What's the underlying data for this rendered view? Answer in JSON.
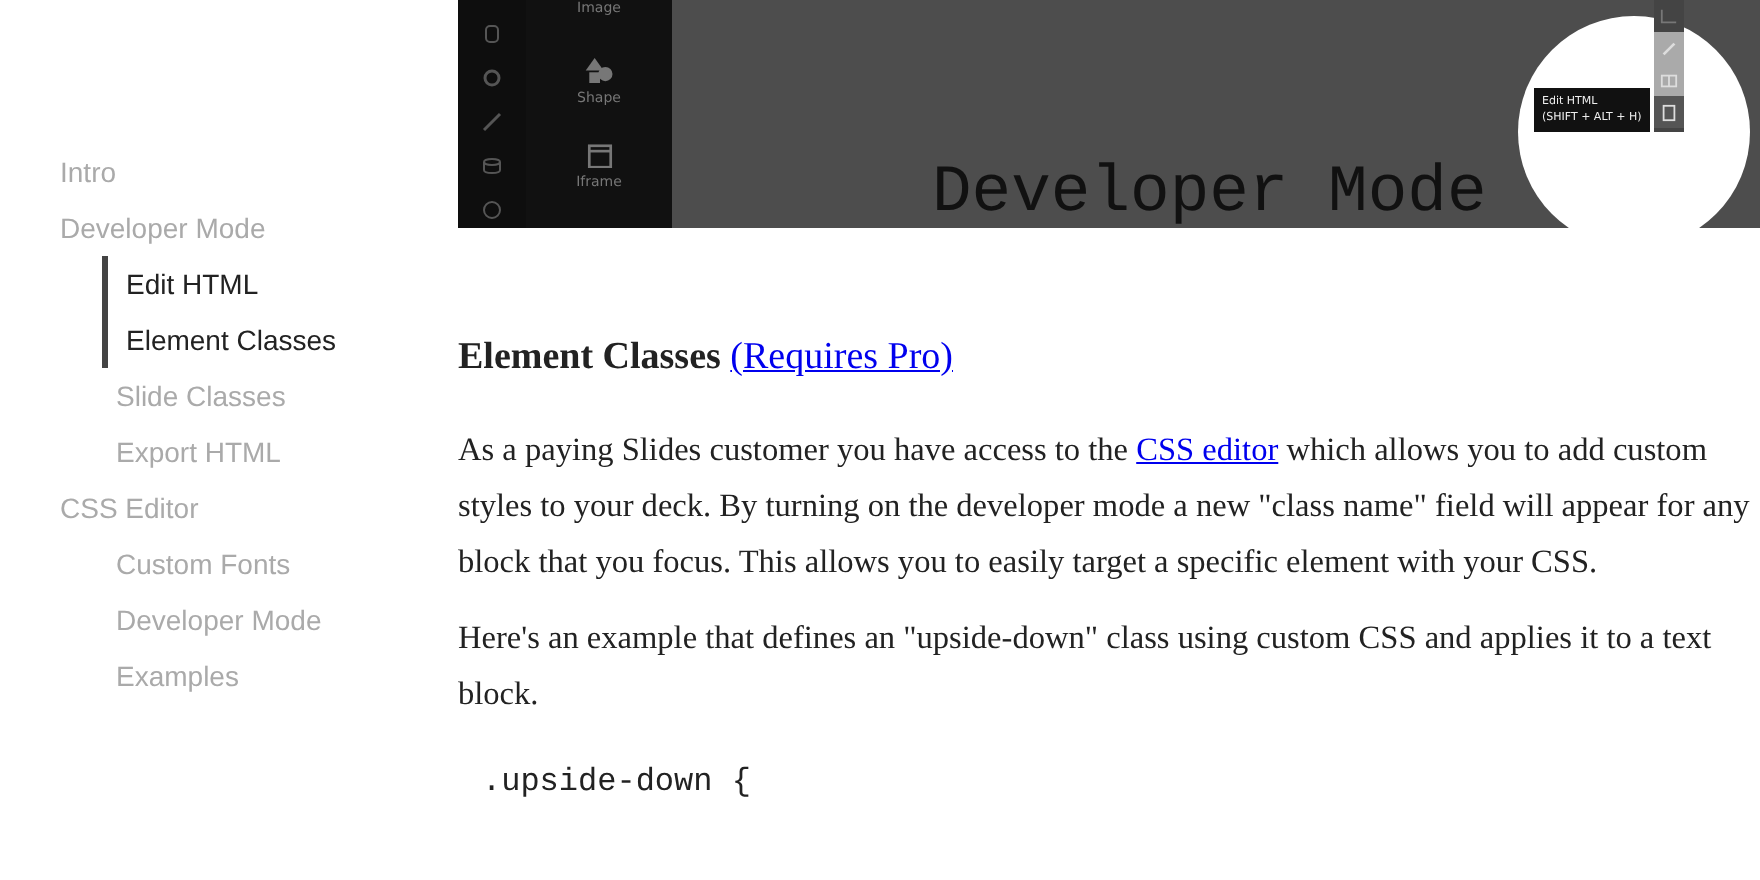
{
  "sidebar": {
    "items": [
      {
        "label": "Intro",
        "selected": false
      },
      {
        "label": "Developer Mode",
        "selected": false,
        "children": [
          {
            "label": "Edit HTML",
            "selected": true
          },
          {
            "label": "Element Classes",
            "selected": true
          },
          {
            "label": "Slide Classes",
            "selected": false
          },
          {
            "label": "Export HTML",
            "selected": false
          }
        ]
      },
      {
        "label": "CSS Editor",
        "selected": false,
        "children": [
          {
            "label": "Custom Fonts",
            "selected": false
          },
          {
            "label": "Developer Mode",
            "selected": false
          },
          {
            "label": "Examples",
            "selected": false
          }
        ]
      }
    ]
  },
  "screenshot": {
    "panel_items": [
      "Image",
      "Shape",
      "Iframe"
    ],
    "slide_title": "Developer Mode",
    "tooltip": {
      "title": "Edit HTML",
      "shortcut": "(SHIFT + ALT + H)"
    }
  },
  "section": {
    "heading": "Element Classes",
    "heading_link": "(Requires Pro)",
    "paragraphs": [
      {
        "before": "As a paying Slides customer you have access to the ",
        "link": "CSS editor",
        "after": " which allows you to add custom styles to your deck. By turning on the developer mode a new \"class name\" field will appear for any block that you focus. This allows you to easily target a specific element with your CSS."
      },
      {
        "before": "Here's an example that defines an \"upside-down\" class using custom CSS and applies it to a text block."
      }
    ],
    "code_lines": [
      ".upside-down {"
    ]
  }
}
